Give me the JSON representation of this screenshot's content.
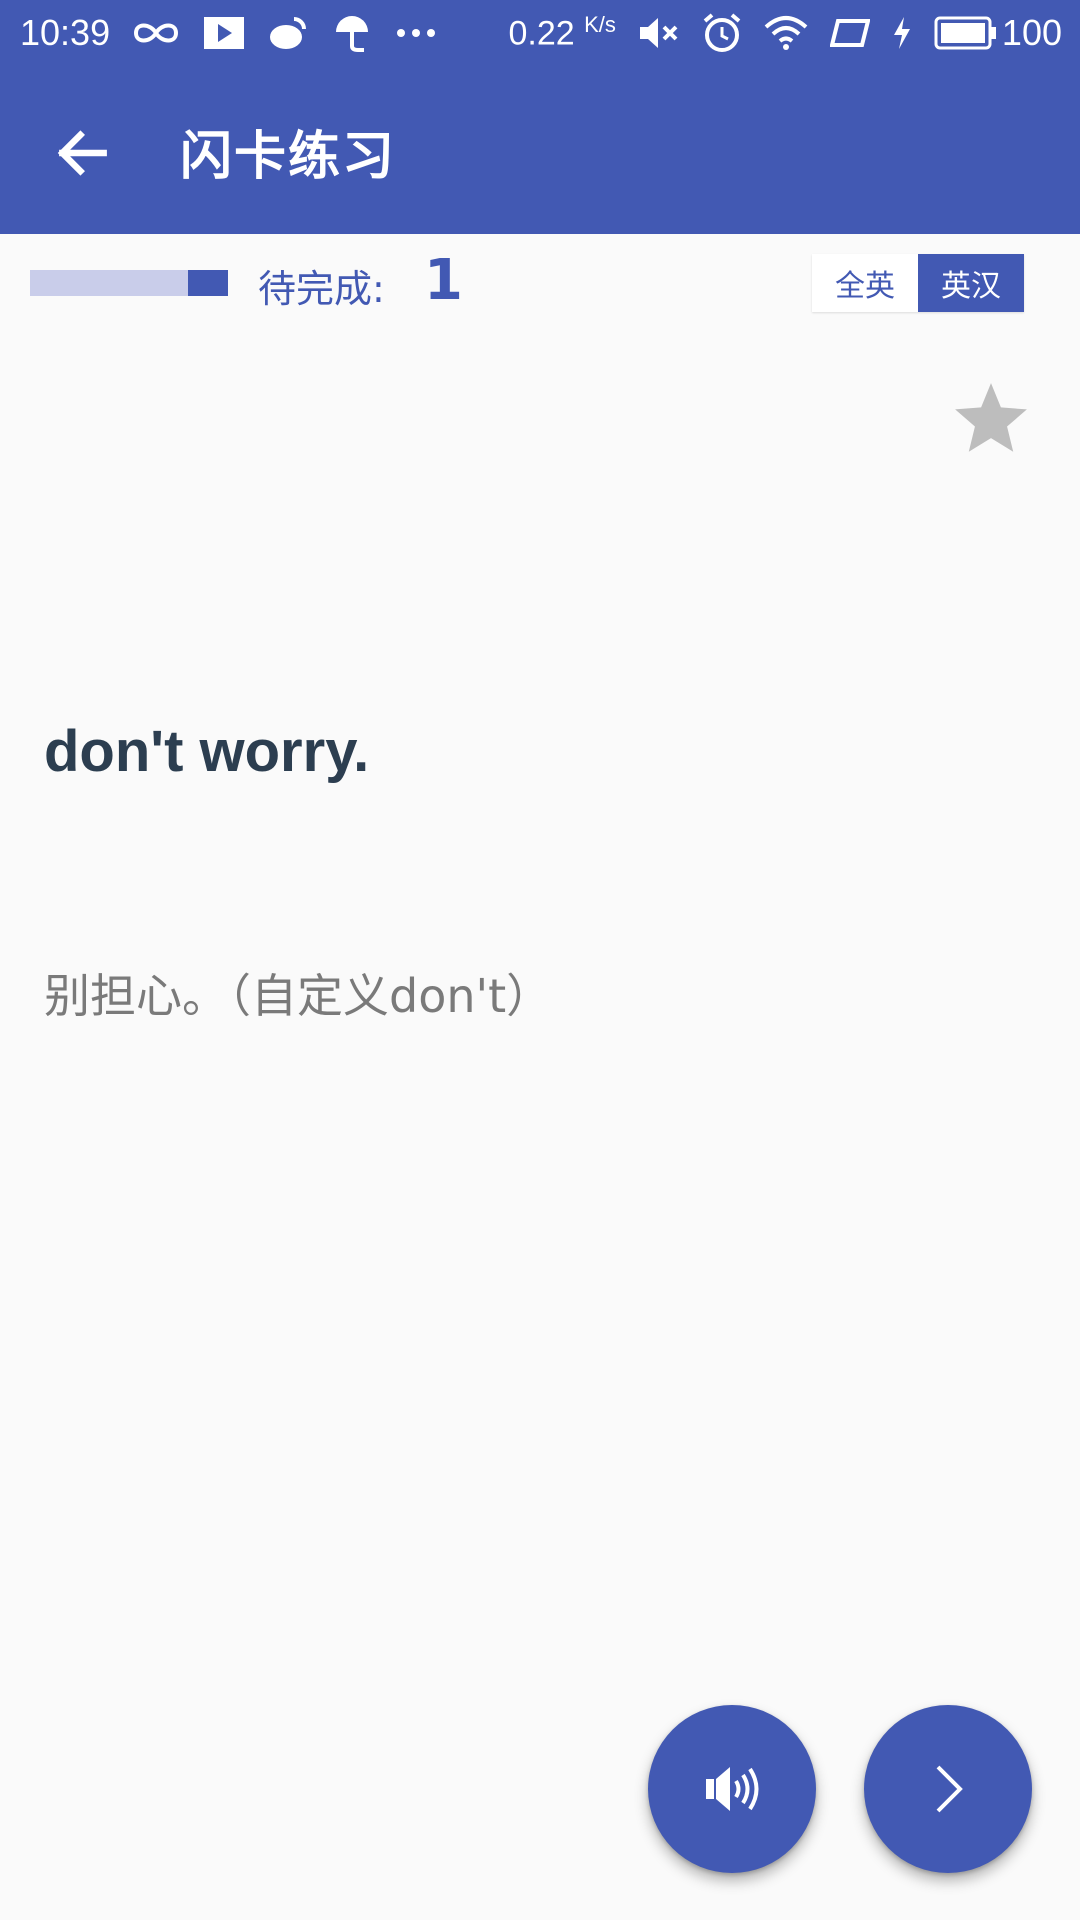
{
  "status_bar": {
    "time": "10:39",
    "speed_value": "0.22",
    "speed_unit": "K/s",
    "battery": "100",
    "icons": [
      "infinity-icon",
      "play-icon",
      "weibo-icon",
      "umbrella-icon",
      "more-dots-icon",
      "mute-icon",
      "alarm-icon",
      "wifi-icon",
      "screen-rotate-icon",
      "charging-icon",
      "battery-icon"
    ]
  },
  "app_bar": {
    "title": "闪卡练习",
    "back_icon": "arrow-back-icon"
  },
  "progress": {
    "label": "待完成:",
    "count": "1",
    "fraction_done": 0.2
  },
  "mode_toggle": {
    "options": [
      "全英",
      "英汉"
    ],
    "selected": "英汉"
  },
  "card": {
    "word": "don't worry.",
    "meaning": "别担心。（自定义don't）"
  },
  "actions": {
    "sound_icon": "speaker-icon",
    "next_icon": "chevron-right-icon",
    "favorite_icon": "star-icon"
  },
  "colors": {
    "primary": "#4259b3",
    "progress_track": "#c9cdea",
    "word_text": "#2c3e50",
    "meaning_text": "#7a7a7a",
    "star": "#bdbdbd",
    "background": "#fafafa"
  }
}
